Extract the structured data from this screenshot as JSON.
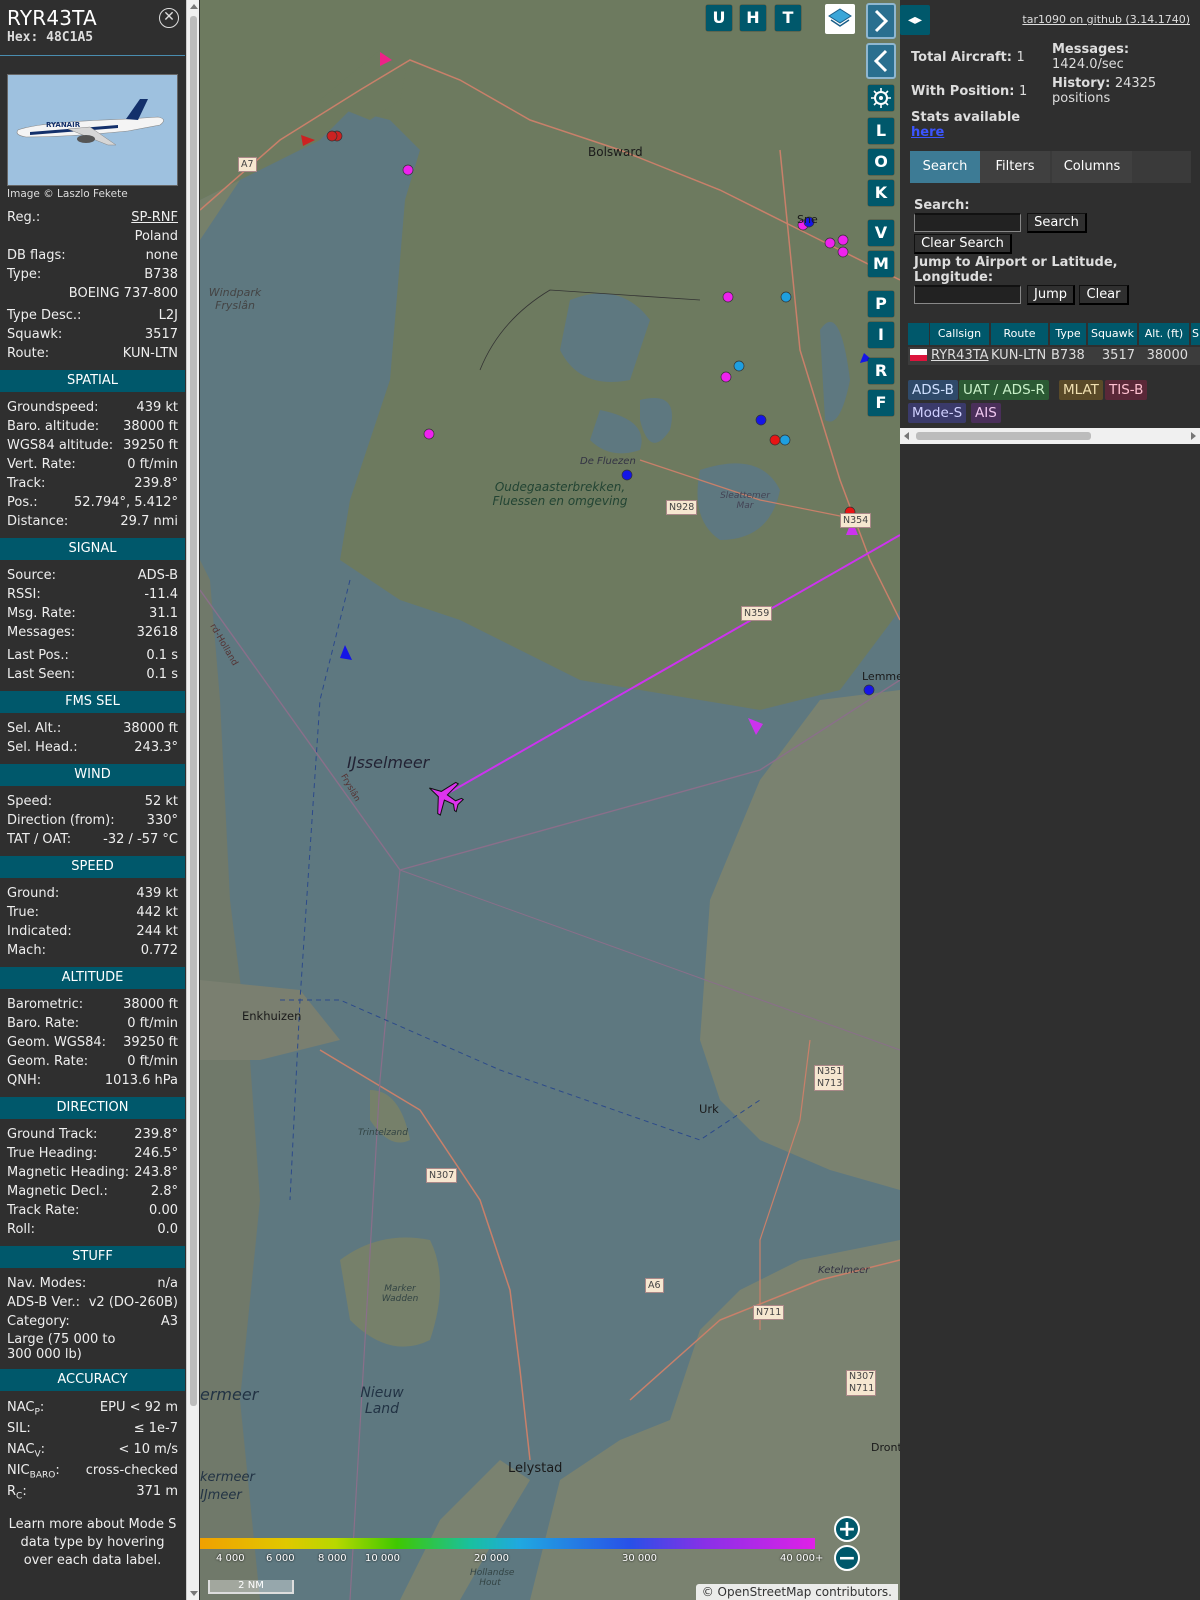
{
  "info": {
    "callsign": "RYR43TA",
    "hex": "Hex: 48C1A5",
    "photo_credit": "Image © Laszlo Fekete",
    "reg_label": "Reg.:",
    "reg": "SP-RNF",
    "country": "Poland",
    "dbflags_label": "DB flags:",
    "dbflags": "none",
    "type_label": "Type:",
    "type": "B738",
    "type_full": "BOEING 737-800",
    "typedesc_label": "Type Desc.:",
    "typedesc": "L2J",
    "squawk_label": "Squawk:",
    "squawk": "3517",
    "route_label": "Route:",
    "route": "KUN-LTN",
    "sections": {
      "spatial": "SPATIAL",
      "signal": "SIGNAL",
      "fms": "FMS SEL",
      "wind": "WIND",
      "speed": "SPEED",
      "altitude": "ALTITUDE",
      "direction": "DIRECTION",
      "stuff": "STUFF",
      "accuracy": "ACCURACY"
    },
    "spatial": [
      {
        "label": "Groundspeed:",
        "value": "439 kt"
      },
      {
        "label": "Baro. altitude:",
        "value": "38000 ft"
      },
      {
        "label": "WGS84 altitude:",
        "value": "39250 ft"
      },
      {
        "label": "Vert. Rate:",
        "value": "0 ft/min"
      },
      {
        "label": "Track:",
        "value": "239.8°"
      },
      {
        "label": "Pos.:",
        "value": "52.794°, 5.412°"
      },
      {
        "label": "Distance:",
        "value": "29.7 nmi"
      }
    ],
    "signal": [
      {
        "label": "Source:",
        "value": "ADS-B"
      },
      {
        "label": "RSSI:",
        "value": "-11.4"
      },
      {
        "label": "Msg. Rate:",
        "value": "31.1"
      },
      {
        "label": "Messages:",
        "value": "32618"
      },
      {
        "label": "Last Pos.:",
        "value": "0.1 s"
      },
      {
        "label": "Last Seen:",
        "value": "0.1 s"
      }
    ],
    "fms": [
      {
        "label": "Sel. Alt.:",
        "value": "38000 ft"
      },
      {
        "label": "Sel. Head.:",
        "value": "243.3°"
      }
    ],
    "wind": [
      {
        "label": "Speed:",
        "value": "52 kt"
      },
      {
        "label": "Direction (from):",
        "value": "330°"
      },
      {
        "label": "TAT / OAT:",
        "value": "-32 / -57 °C"
      }
    ],
    "speed": [
      {
        "label": "Ground:",
        "value": "439 kt"
      },
      {
        "label": "True:",
        "value": "442 kt"
      },
      {
        "label": "Indicated:",
        "value": "244 kt"
      },
      {
        "label": "Mach:",
        "value": "0.772"
      }
    ],
    "altitude": [
      {
        "label": "Barometric:",
        "value": "38000 ft"
      },
      {
        "label": "Baro. Rate:",
        "value": "0 ft/min"
      },
      {
        "label": "Geom. WGS84:",
        "value": "39250 ft"
      },
      {
        "label": "Geom. Rate:",
        "value": "0 ft/min"
      },
      {
        "label": "QNH:",
        "value": "1013.6 hPa"
      }
    ],
    "direction": [
      {
        "label": "Ground Track:",
        "value": "239.8°"
      },
      {
        "label": "True Heading:",
        "value": "246.5°"
      },
      {
        "label": "Magnetic Heading:",
        "value": "243.8°"
      },
      {
        "label": "Magnetic Decl.:",
        "value": "2.8°"
      },
      {
        "label": "Track Rate:",
        "value": "0.00"
      },
      {
        "label": "Roll:",
        "value": "0.0"
      }
    ],
    "stuff": [
      {
        "label": "Nav. Modes:",
        "value": "n/a"
      },
      {
        "label": "ADS-B Ver.:",
        "value": "v2 (DO-260B)"
      },
      {
        "label": "Category:",
        "value": "A3"
      }
    ],
    "category_desc": "Large (75 000 to 300 000 lb)",
    "accuracy": [
      {
        "label": "NAC",
        "sub": "P",
        "label_end": ":",
        "value": "EPU < 92 m"
      },
      {
        "label": "SIL:",
        "sub": "",
        "label_end": "",
        "value": "≤ 1e-7"
      },
      {
        "label": "NAC",
        "sub": "V",
        "label_end": ":",
        "value": "< 10 m/s"
      },
      {
        "label": "NIC",
        "sub": "BARO",
        "label_end": ":",
        "value": "cross-checked"
      },
      {
        "label": "R",
        "sub": "C",
        "label_end": ":",
        "value": "371 m"
      }
    ],
    "note": "Learn more about Mode S data type by hovering over each data label."
  },
  "map": {
    "buttons": [
      "U",
      "H",
      "T"
    ],
    "side_buttons": [
      "L",
      "O",
      "K",
      "V",
      "M",
      "P",
      "I",
      "R",
      "F"
    ],
    "places": [
      {
        "name": "Bolsward"
      },
      {
        "name": "Windpark Fryslân"
      },
      {
        "name": "Oudegaasterbrekken, Fluessen en omgeving"
      },
      {
        "name": "De Fluezen"
      },
      {
        "name": "Sleattemer Mar"
      },
      {
        "name": "IJsselmeer"
      },
      {
        "name": "Enkhuizen"
      },
      {
        "name": "Urk"
      },
      {
        "name": "Trintelzand"
      },
      {
        "name": "Marker Wadden"
      },
      {
        "name": "Nieuw Land"
      },
      {
        "name": "Lelystad"
      },
      {
        "name": "Ketelmeer"
      },
      {
        "name": "Lemme"
      },
      {
        "name": "Sne"
      },
      {
        "name": "Dront"
      },
      {
        "name": "ermeer"
      },
      {
        "name": "kermeer IJmeer"
      },
      {
        "name": "Hollandse Hout"
      },
      {
        "name": "Fryslân"
      },
      {
        "name": "rd-Holland"
      }
    ],
    "roads": [
      "A7",
      "N928",
      "N359",
      "N354",
      "N307",
      "A6",
      "N711",
      "N351 N713",
      "N307 N711"
    ],
    "legend_ticks": [
      "4 000",
      "6 000",
      "8 000",
      "10 000",
      "20 000",
      "30 000",
      "40 000+"
    ],
    "scale": "2 NM",
    "attribution": "© OpenStreetMap contributors.",
    "track_color": "#cc33ee"
  },
  "side": {
    "github": "tar1090 on github (3.14.1740)",
    "total_label": "Total Aircraft:",
    "total": "1",
    "withpos_label": "With Position:",
    "withpos": "1",
    "stats_label": "Stats available",
    "stats_link": "here",
    "messages_label": "Messages:",
    "messages": "1424.0/sec",
    "history_label": "History:",
    "history": "24325 positions",
    "tabs": [
      "Search",
      "Filters",
      "Columns"
    ],
    "search_label": "Search:",
    "search_btn": "Search",
    "clear_search_btn": "Clear Search",
    "jump_label": "Jump to Airport or Latitude, Longitude:",
    "jump_btn": "Jump",
    "clear_btn": "Clear",
    "columns": [
      "Callsign",
      "Route",
      "Type",
      "Squawk",
      "Alt. (ft)",
      "S"
    ],
    "row": {
      "callsign": "RYR43TA",
      "route": "KUN-LTN",
      "type": "B738",
      "squawk": "3517",
      "alt": "38000"
    },
    "sources": [
      {
        "name": "ADS-B",
        "bg": "#2f4a6a",
        "fg": "#cfe0ff"
      },
      {
        "name": "UAT / ADS-R",
        "bg": "#2b5a34",
        "fg": "#c8f0c8"
      },
      {
        "name": "MLAT",
        "bg": "#5a4a28",
        "fg": "#f0e0b0"
      },
      {
        "name": "TIS-B",
        "bg": "#5a2838",
        "fg": "#ffc0d0"
      },
      {
        "name": "Mode-S",
        "bg": "#3a3a6a",
        "fg": "#d0d0ff"
      },
      {
        "name": "AIS",
        "bg": "#4a2f5a",
        "fg": "#f0c8f0"
      }
    ]
  }
}
